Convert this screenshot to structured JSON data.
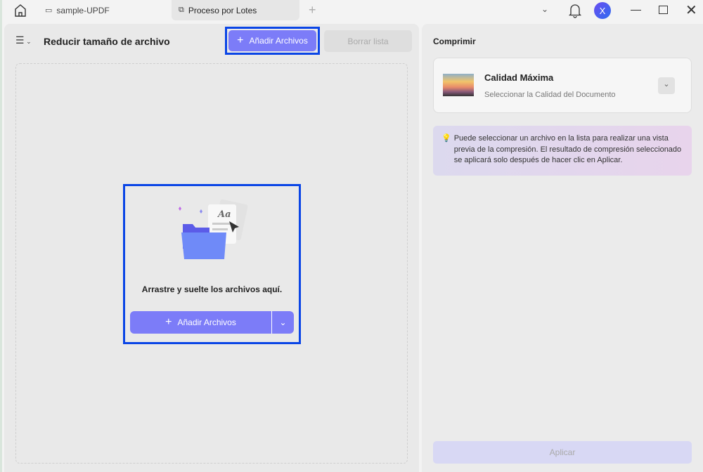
{
  "tabs": [
    {
      "label": "sample-UPDF",
      "icon": "monitor-icon"
    },
    {
      "label": "Proceso por Lotes",
      "icon": "batch-icon",
      "active": true
    }
  ],
  "avatar": "X",
  "left": {
    "title": "Reducir tamaño de archivo",
    "add_files": "Añadir Archivos",
    "clear_list": "Borrar lista",
    "drop_text": "Arrastre y suelte los archivos aquí.",
    "drop_add_files": "Añadir Archivos"
  },
  "right": {
    "heading": "Comprimir",
    "quality_title": "Calidad Máxima",
    "quality_sub": "Seleccionar la Calidad del Documento",
    "tip": "Puede seleccionar un archivo en la lista para realizar una vista previa de la compresión. El resultado de compresión seleccionado se aplicará solo después de hacer clic en Aplicar.",
    "apply": "Aplicar"
  },
  "colors": {
    "accent": "#7c7cf8",
    "highlight": "#0a45e6"
  }
}
